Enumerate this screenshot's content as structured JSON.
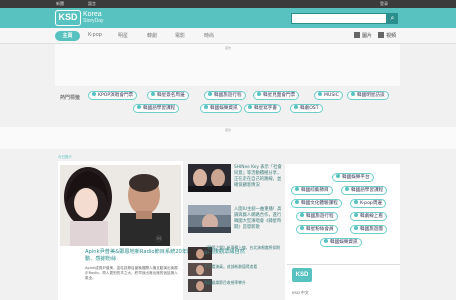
{
  "topbar": {
    "left": [
      "新聞",
      "韓國",
      "語言"
    ],
    "right": "登录"
  },
  "brand": {
    "name": "KSD",
    "line1": "Korea",
    "line2": "StoryDay"
  },
  "search": {
    "placeholder": ""
  },
  "nav": {
    "items": [
      "主頁",
      "K-pop",
      "明星",
      "韓劇",
      "電影",
      "時尚"
    ],
    "right": [
      "圖片",
      "視頻"
    ]
  },
  "ads": {
    "label": "廣告"
  },
  "tags": {
    "title": "熱門標籤",
    "row1": [
      "KPOP演唱會門票",
      "韓星簽名周邊",
      "韓國旅遊行程",
      "韓星見面會門票",
      "MUSIC",
      "韓國明星訪談"
    ],
    "row2": [
      "韓國語學習課程",
      "韓國娛樂資訊",
      "韓星寫字書",
      "韓劇OST"
    ]
  },
  "featured": {
    "label": "今日推介",
    "headline": "Apink尹普美&鄭恩地新Radio節目系統20年開啟線+ 隨後觀眾緣自然動、感謝粉絲",
    "body": "Apink成員尹普美、金柱延節目當晚展開人機互動演出後展示Radio，再人更別的羊之大，終早我出席出席的追話與人氣全。"
  },
  "news": [
    {
      "text": "SHINee Key 表示「社會同意」等活動積極分享，正在走在自己的路線，並確保顧客情況"
    },
    {
      "text": "入圍IU主創一曲重播！高調與藝人網路合作，進行韓國大型演唱會《韓星時期》首發新歌"
    },
    {
      "text": "《國際之聲》新專輯上線，台北演唱會將如期舉行"
    },
    {
      "text": "不只看演員，這部新劇值得追看"
    },
    {
      "text": "韓國娛樂節目收視率攀升"
    }
  ],
  "sidebar": {
    "tags": [
      "韓國娛樂平台",
      "韓國綜藝節目",
      "韓國語學習課程",
      "韓國文化體驗課程",
      "K-pop周邊",
      "韓國旅遊行程",
      "韓劇線上看",
      "韓星粉絲會員",
      "韓國旅遊團",
      "韓國娛樂資訊"
    ],
    "mini_brand": "KSD",
    "mini_caption": "KSD 中文"
  }
}
